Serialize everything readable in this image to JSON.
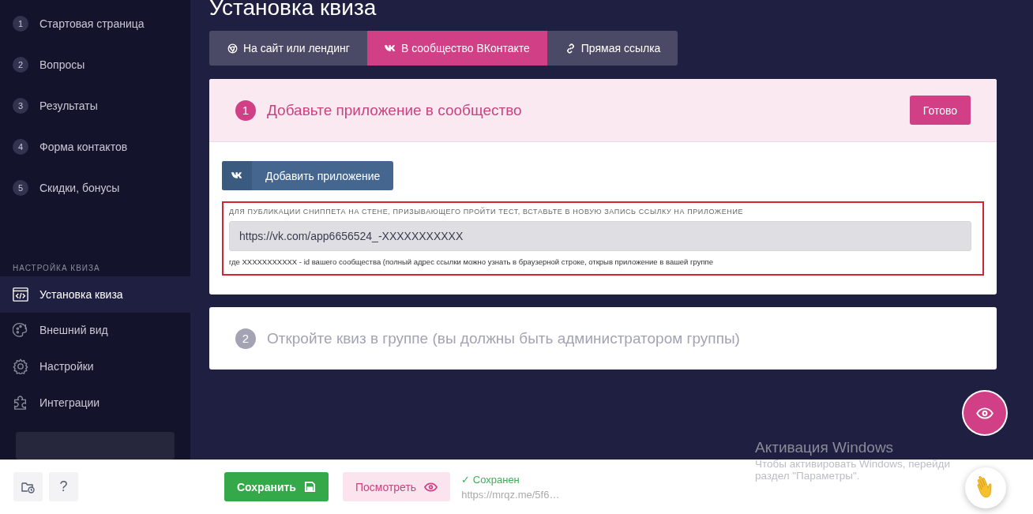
{
  "page_title": "Установка квиза",
  "sidebar": {
    "steps": [
      {
        "number": "1",
        "label": "Стартовая страница",
        "selected": false
      },
      {
        "number": "2",
        "label": "Вопросы",
        "selected": false
      },
      {
        "number": "3",
        "label": "Результаты",
        "selected": false
      },
      {
        "number": "4",
        "label": "Форма контактов",
        "selected": false
      },
      {
        "number": "5",
        "label": "Скидки, бонусы",
        "selected": false
      }
    ],
    "section_label": "НАСТРОЙКА КВИЗА",
    "settings": [
      {
        "kind": "code",
        "label": "Установка квиза",
        "selected": true
      },
      {
        "kind": "palette",
        "label": "Внешний вид",
        "selected": false
      },
      {
        "kind": "gear",
        "label": "Настройки",
        "selected": false
      },
      {
        "kind": "puzzle",
        "label": "Интеграции",
        "selected": false
      }
    ]
  },
  "tabs": [
    {
      "kind": "chrome",
      "label": "На сайт или лендинг",
      "selected": false
    },
    {
      "kind": "vk",
      "label": "В сообщество ВКонтакте",
      "selected": true
    },
    {
      "kind": "link",
      "label": "Прямая ссылка",
      "selected": false
    }
  ],
  "step1": {
    "number": "1",
    "title": "Добавьте приложение в сообщество",
    "done_button": "Готово",
    "add_button": "Добавить приложение",
    "hint": "ДЛЯ ПУБЛИКАЦИИ СНИППЕТА НА СТЕНЕ, ПРИЗЫВАЮЩЕГО ПРОЙТИ ТЕСТ, ВСТАВЬТЕ В НОВУЮ ЗАПИСЬ ССЫЛКУ НА ПРИЛОЖЕНИЕ",
    "link_value": "https://vk.com/app6656524_-XXXXXXXXXXX",
    "note": "где XXXXXXXXXXX - id вашего сообщества (полный адрес ссылки можно узнать в браузерной строке, открыв приложение в вашей группе"
  },
  "step2": {
    "number": "2",
    "title": "Откройте квиз в группе (вы должны быть администратором группы)"
  },
  "bottom_bar": {
    "help": "?",
    "save": "Сохранить",
    "preview": "Посмотреть",
    "status": "✓ Сохранен",
    "url": "https://mrqz.me/5f6…"
  },
  "windows_notice": {
    "title": "Активация Windows",
    "line_1": "Чтобы активировать Windows, перейди",
    "line_2": "раздел \"Параметры\"."
  }
}
